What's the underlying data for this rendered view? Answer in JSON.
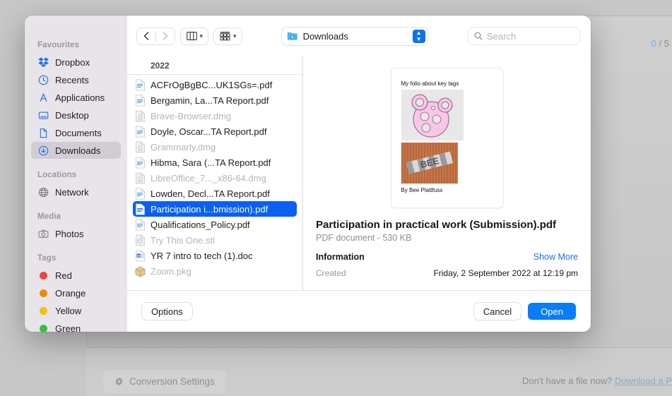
{
  "background": {
    "counter_current": "0",
    "counter_sep": "/",
    "counter_total": "5",
    "conversion_settings_label": "Conversion Settings",
    "conversion_settings_icon": "gear-icon",
    "prompt_text": "Don't have a file now?",
    "prompt_link": "Download a P"
  },
  "dialog": {
    "sidebar": {
      "sections": [
        {
          "title": "Favourites",
          "items": [
            {
              "label": "Dropbox",
              "icon": "dropbox-icon"
            },
            {
              "label": "Recents",
              "icon": "clock-icon"
            },
            {
              "label": "Applications",
              "icon": "applications-icon"
            },
            {
              "label": "Desktop",
              "icon": "desktop-icon"
            },
            {
              "label": "Documents",
              "icon": "document-icon"
            },
            {
              "label": "Downloads",
              "icon": "download-icon",
              "active": true
            }
          ]
        },
        {
          "title": "Locations",
          "items": [
            {
              "label": "Network",
              "icon": "globe-icon"
            }
          ]
        },
        {
          "title": "Media",
          "items": [
            {
              "label": "Photos",
              "icon": "camera-icon"
            }
          ]
        },
        {
          "title": "Tags",
          "items": [
            {
              "label": "Red",
              "icon": "tag-dot-icon",
              "color": "#f5423c"
            },
            {
              "label": "Orange",
              "icon": "tag-dot-icon",
              "color": "#ef8a08"
            },
            {
              "label": "Yellow",
              "icon": "tag-dot-icon",
              "color": "#f0c20c"
            },
            {
              "label": "Green",
              "icon": "tag-dot-icon",
              "color": "#35c240"
            }
          ]
        }
      ]
    },
    "toolbar": {
      "back_icon": "chevron-left-icon",
      "forward_icon": "chevron-right-icon",
      "view_column_icon": "column-view-icon",
      "view_gallery_icon": "gallery-view-icon",
      "chevron_icon": "chevron-down-icon",
      "path_label": "Downloads",
      "path_folder_icon": "downloads-folder-icon",
      "path_stepper_icon": "stepper-updown-icon",
      "search_icon": "search-icon",
      "search_placeholder": "Search",
      "search_value": ""
    },
    "filelist": {
      "group_header": "2022",
      "files": [
        {
          "name": "ACFrOgBgBC...UK1SGs=.pdf",
          "type": "pdf",
          "enabled": true
        },
        {
          "name": "Bergamin, La...TA Report.pdf",
          "type": "pdf",
          "enabled": true
        },
        {
          "name": "Brave-Browser.dmg",
          "type": "dmg",
          "enabled": false
        },
        {
          "name": "Doyle, Oscar...TA Report.pdf",
          "type": "pdf",
          "enabled": true
        },
        {
          "name": "Grammarly.dmg",
          "type": "dmg",
          "enabled": false
        },
        {
          "name": "Hibma, Sara (...TA Report.pdf",
          "type": "pdf",
          "enabled": true
        },
        {
          "name": "LibreOffice_7..._x86-64.dmg",
          "type": "dmg",
          "enabled": false
        },
        {
          "name": "Lowden, Decl...TA Report.pdf",
          "type": "pdf",
          "enabled": true
        },
        {
          "name": "Participation i...bmission).pdf",
          "type": "pdf",
          "enabled": true,
          "selected": true
        },
        {
          "name": "Qualifications_Policy.pdf",
          "type": "pdf",
          "enabled": true
        },
        {
          "name": "Try This One.stl",
          "type": "stl",
          "enabled": false
        },
        {
          "name": "YR 7 intro to tech (1).doc",
          "type": "doc",
          "enabled": true
        },
        {
          "name": "Zoom.pkg",
          "type": "pkg",
          "enabled": false
        }
      ]
    },
    "preview": {
      "thumbnail": {
        "title": "My folio about key tags",
        "byline": "By Bee Plattfuss",
        "image1_alt": "pink-key-tag-render",
        "image2_alt": "bee-keytag-photo"
      },
      "file_name": "Participation in practical work (Submission).pdf",
      "file_meta": "PDF document - 530 KB",
      "information_header": "Information",
      "show_more_label": "Show More",
      "rows": [
        {
          "key": "Created",
          "value": "Friday, 2 September 2022 at 12:19 pm"
        }
      ]
    },
    "footer": {
      "options_label": "Options",
      "cancel_label": "Cancel",
      "open_label": "Open"
    }
  }
}
